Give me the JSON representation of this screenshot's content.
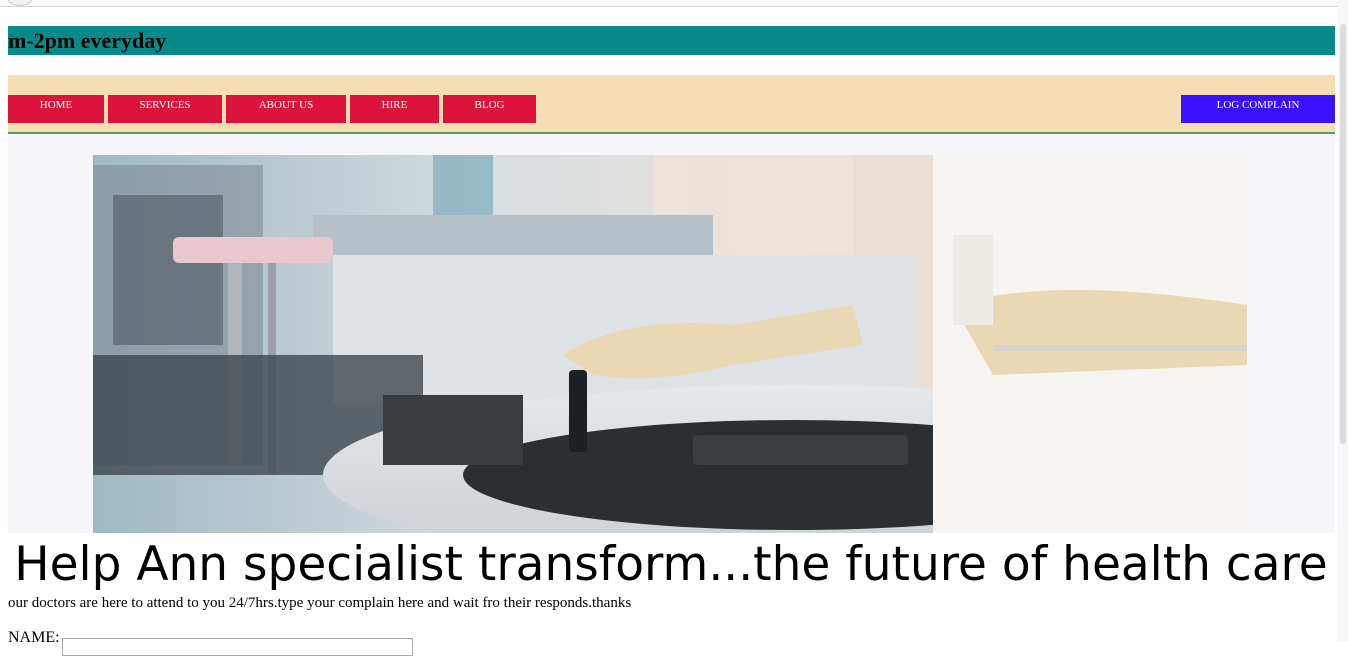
{
  "header": {
    "hours_text": "m-2pm everyday"
  },
  "nav": {
    "items": [
      {
        "label": "HOME"
      },
      {
        "label": "SERVICES"
      },
      {
        "label": "ABOUT US"
      },
      {
        "label": "HIRE"
      },
      {
        "label": "BLOG"
      }
    ],
    "log_complain": "LOG COMPLAIN",
    "colors": {
      "bar": "#f5deb3",
      "button": "#dc143c",
      "log_button": "#3a10ff",
      "hours_bar": "#088a8a"
    }
  },
  "hero": {
    "image": "laboratory-photo"
  },
  "main": {
    "headline": "Help Ann specialist transform...the future of health care",
    "tagline": "our doctors are here to attend to you 24/7hrs.type your complain here and wait fro their responds.thanks"
  },
  "form": {
    "name_label": "NAME:"
  }
}
